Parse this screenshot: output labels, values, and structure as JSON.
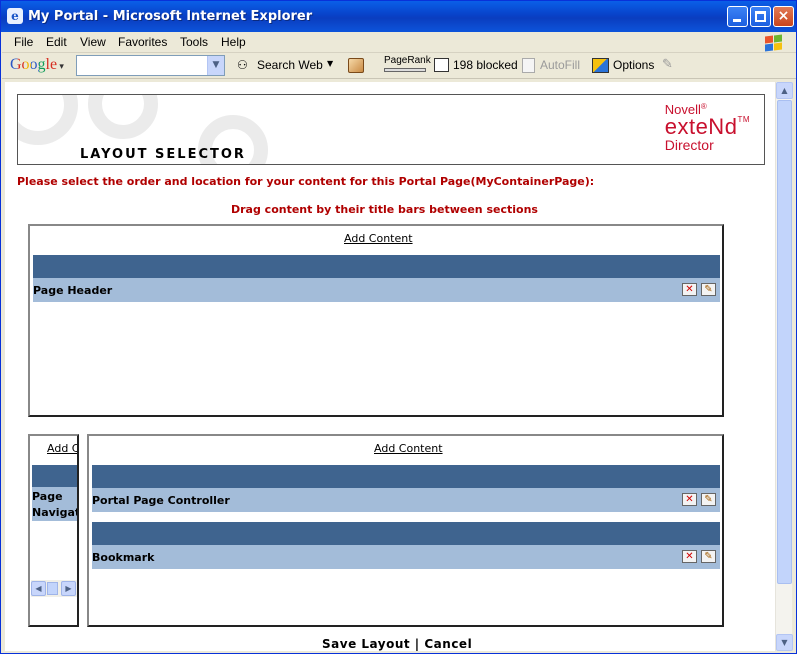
{
  "window": {
    "title": "My Portal - Microsoft Internet Explorer"
  },
  "menu": [
    "File",
    "Edit",
    "View",
    "Favorites",
    "Tools",
    "Help"
  ],
  "toolbar": {
    "google_label": "Google",
    "search_web": "Search Web",
    "pagerank": "PageRank",
    "blocked": "198 blocked",
    "autofill": "AutoFill",
    "options": "Options"
  },
  "banner": {
    "title": "LAYOUT SELECTOR",
    "brand_company": "Novell",
    "brand_product": "exteNd",
    "brand_tm": "TM",
    "brand_sub": "Director"
  },
  "instructions": {
    "line1": "Please select the order and location for your content for this Portal Page(MyContainerPage):",
    "line2": "Drag content by their title bars between sections"
  },
  "sections": {
    "top": {
      "add_label": "Add Content",
      "portlets": [
        "Page Header"
      ]
    },
    "left": {
      "add_label": "Add Co",
      "portlets": [
        "Page Navigati"
      ]
    },
    "main": {
      "add_label": "Add Content",
      "portlets": [
        "Portal Page Controller",
        "Bookmark"
      ]
    }
  },
  "footer": {
    "save": "Save Layout",
    "separator": "|",
    "cancel": "Cancel"
  },
  "colors": {
    "bar_dark": "#3f648f",
    "bar_light": "#a3bcd9",
    "instruction_red": "#b00000",
    "brand_red": "#c8102e",
    "titlebar_blue": "#0842c9"
  }
}
